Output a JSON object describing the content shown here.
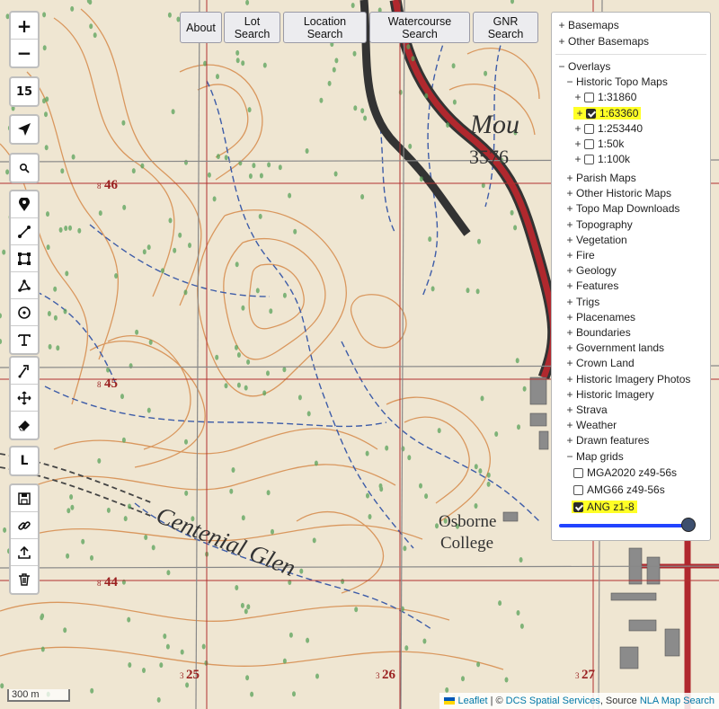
{
  "toolbar": {
    "zoom_in": "+",
    "zoom_out": "−",
    "zoom_level": "15",
    "layer_letter": "L"
  },
  "icons": [
    "locate-icon",
    "search-icon",
    "marker-icon",
    "polyline-icon",
    "rectangle-icon",
    "polygon-icon",
    "circle-icon",
    "text-icon",
    "edit-icon",
    "move-icon",
    "eraser-icon",
    "save-icon",
    "link-icon",
    "upload-icon",
    "trash-icon"
  ],
  "top_buttons": {
    "about": "About",
    "lot": "Lot Search",
    "location": "Location Search",
    "watercourse": "Watercourse Search",
    "gnr": "GNR Search"
  },
  "panel": {
    "basemaps": "Basemaps",
    "other_basemaps": "Other Basemaps",
    "overlays": "Overlays",
    "historic_topo": "Historic Topo Maps",
    "scales": [
      {
        "label": "1:31860",
        "checked": false,
        "highlight": false
      },
      {
        "label": "1:63360",
        "checked": true,
        "highlight": true
      },
      {
        "label": "1:253440",
        "checked": false,
        "highlight": false
      },
      {
        "label": "1:50k",
        "checked": false,
        "highlight": false
      },
      {
        "label": "1:100k",
        "checked": false,
        "highlight": false
      }
    ],
    "groups": [
      "Parish Maps",
      "Other Historic Maps",
      "Topo Map Downloads",
      "Topography",
      "Vegetation",
      "Fire",
      "Geology",
      "Features",
      "Trigs",
      "Placenames",
      "Boundaries",
      "Government lands",
      "Crown Land",
      "Historic Imagery Photos",
      "Historic Imagery",
      "Strava",
      "Weather",
      "Drawn features"
    ],
    "map_grids": "Map grids",
    "grids": [
      {
        "label": "MGA2020 z49-56s",
        "checked": false,
        "highlight": false
      },
      {
        "label": "AMG66 z49-56s",
        "checked": false,
        "highlight": false
      },
      {
        "label": "ANG z1-8",
        "checked": true,
        "highlight": true
      }
    ],
    "opacity": 1.0
  },
  "map": {
    "mountain_label": "Mou",
    "height": "3576",
    "glen_label": "Centenial Glen",
    "college_1": "Osborne",
    "college_2": "College",
    "grid_rows": [
      {
        "small": "8",
        "big": "46"
      },
      {
        "small": "8",
        "big": "45"
      },
      {
        "small": "8",
        "big": "44"
      }
    ],
    "grid_cols": [
      {
        "small": "3",
        "big": "25"
      },
      {
        "small": "3",
        "big": "26"
      },
      {
        "small": "3",
        "big": "27"
      }
    ]
  },
  "scale_bar": "300 m",
  "attribution": {
    "leaflet": "Leaflet",
    "sep1": " | © ",
    "dcs": "DCS Spatial Services",
    "source": ", Source ",
    "nla": "NLA Map Search"
  },
  "colors": {
    "grid": "#b03030",
    "contour": "#d68a4a",
    "stream": "#3d5ca8",
    "road": "#b0282e",
    "veg": "#5aa35a",
    "highlight": "#ffff26"
  }
}
